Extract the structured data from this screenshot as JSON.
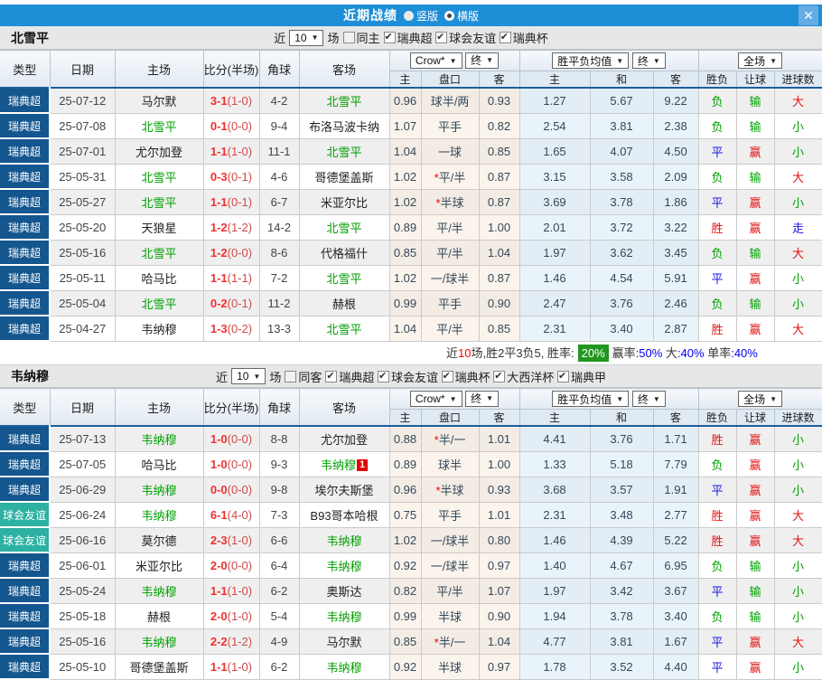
{
  "colors": {
    "topbar_blue": "#1e8ed7",
    "league_super_navy": "#14568e",
    "league_friendly_teal": "#2cb1a2",
    "focus_team_green": "#00a000",
    "score_red": "#f03030",
    "win_red": "#e11515",
    "draw_blue": "#1a1ae6",
    "lose_green": "#00a000",
    "summary_badge_green": "#21971f"
  },
  "titlebar": {
    "title": "近期战绩",
    "vertical_label": "竖版",
    "horizontal_label": "横版",
    "close_glyph": "✕"
  },
  "columns": {
    "main": [
      "类型",
      "日期",
      "主场",
      "比分(半场)",
      "角球",
      "客场"
    ],
    "sub": [
      "主",
      "盘口",
      "客",
      "主",
      "和",
      "客",
      "胜负",
      "让球",
      "进球数"
    ]
  },
  "dropdowns": {
    "company": "Crow*",
    "final": "终",
    "avg": "胜平负均值",
    "fulltime": "全场",
    "arrow": "▼"
  },
  "type_class": {
    "瑞典超": "ty-super",
    "球会友谊": "ty-friendly"
  },
  "result_class": {
    "胜": "c-red",
    "平": "c-blue",
    "负": "c-green",
    "赢": "c-red",
    "输": "c-green",
    "大": "c-red",
    "小": "c-green",
    "走": "c-blue"
  },
  "sections": [
    {
      "team": "北雪平",
      "focus": {
        "北雪平": "focus"
      },
      "filter": {
        "near": "近",
        "count": "10",
        "games": "场",
        "same": "同主",
        "leagues": [
          "瑞典超",
          "球会友谊",
          "瑞典杯"
        ]
      },
      "rows": [
        {
          "type": "瑞典超",
          "date": "25-07-12",
          "home": "马尔默",
          "score": "3-1",
          "half": "(1-0)",
          "corner": "4-2",
          "away": "北雪平",
          "o1": "0.96",
          "ast": "",
          "hcap": "球半/两",
          "o2": "0.93",
          "a1": "1.27",
          "a2": "5.67",
          "a3": "9.22",
          "r1": "负",
          "r2": "输",
          "r3": "大"
        },
        {
          "type": "瑞典超",
          "date": "25-07-08",
          "home": "北雪平",
          "score": "0-1",
          "half": "(0-0)",
          "corner": "9-4",
          "away": "布洛马波卡纳",
          "o1": "1.07",
          "ast": "",
          "hcap": "平手",
          "o2": "0.82",
          "a1": "2.54",
          "a2": "3.81",
          "a3": "2.38",
          "r1": "负",
          "r2": "输",
          "r3": "小"
        },
        {
          "type": "瑞典超",
          "date": "25-07-01",
          "home": "尤尔加登",
          "score": "1-1",
          "half": "(1-0)",
          "corner": "11-1",
          "away": "北雪平",
          "o1": "1.04",
          "ast": "",
          "hcap": "一球",
          "o2": "0.85",
          "a1": "1.65",
          "a2": "4.07",
          "a3": "4.50",
          "r1": "平",
          "r2": "赢",
          "r3": "小"
        },
        {
          "type": "瑞典超",
          "date": "25-05-31",
          "home": "北雪平",
          "score": "0-3",
          "half": "(0-1)",
          "corner": "4-6",
          "away": "哥德堡盖斯",
          "o1": "1.02",
          "ast": "*",
          "hcap": "平/半",
          "o2": "0.87",
          "a1": "3.15",
          "a2": "3.58",
          "a3": "2.09",
          "r1": "负",
          "r2": "输",
          "r3": "大"
        },
        {
          "type": "瑞典超",
          "date": "25-05-27",
          "home": "北雪平",
          "score": "1-1",
          "half": "(0-1)",
          "corner": "6-7",
          "away": "米亚尔比",
          "o1": "1.02",
          "ast": "*",
          "hcap": "半球",
          "o2": "0.87",
          "a1": "3.69",
          "a2": "3.78",
          "a3": "1.86",
          "r1": "平",
          "r2": "赢",
          "r3": "小"
        },
        {
          "type": "瑞典超",
          "date": "25-05-20",
          "home": "天狼星",
          "score": "1-2",
          "half": "(1-2)",
          "corner": "14-2",
          "away": "北雪平",
          "o1": "0.89",
          "ast": "",
          "hcap": "平/半",
          "o2": "1.00",
          "a1": "2.01",
          "a2": "3.72",
          "a3": "3.22",
          "r1": "胜",
          "r2": "赢",
          "r3": "走"
        },
        {
          "type": "瑞典超",
          "date": "25-05-16",
          "home": "北雪平",
          "score": "1-2",
          "half": "(0-0)",
          "corner": "8-6",
          "away": "代格福什",
          "o1": "0.85",
          "ast": "",
          "hcap": "平/半",
          "o2": "1.04",
          "a1": "1.97",
          "a2": "3.62",
          "a3": "3.45",
          "r1": "负",
          "r2": "输",
          "r3": "大"
        },
        {
          "type": "瑞典超",
          "date": "25-05-11",
          "home": "哈马比",
          "score": "1-1",
          "half": "(1-1)",
          "corner": "7-2",
          "away": "北雪平",
          "o1": "1.02",
          "ast": "",
          "hcap": "一/球半",
          "o2": "0.87",
          "a1": "1.46",
          "a2": "4.54",
          "a3": "5.91",
          "r1": "平",
          "r2": "赢",
          "r3": "小"
        },
        {
          "type": "瑞典超",
          "date": "25-05-04",
          "home": "北雪平",
          "score": "0-2",
          "half": "(0-1)",
          "corner": "11-2",
          "away": "赫根",
          "o1": "0.99",
          "ast": "",
          "hcap": "平手",
          "o2": "0.90",
          "a1": "2.47",
          "a2": "3.76",
          "a3": "2.46",
          "r1": "负",
          "r2": "输",
          "r3": "小"
        },
        {
          "type": "瑞典超",
          "date": "25-04-27",
          "home": "韦纳穆",
          "score": "1-3",
          "half": "(0-2)",
          "corner": "13-3",
          "away": "北雪平",
          "o1": "1.04",
          "ast": "",
          "hcap": "平/半",
          "o2": "0.85",
          "a1": "2.31",
          "a2": "3.40",
          "a3": "2.87",
          "r1": "胜",
          "r2": "赢",
          "r3": "大"
        }
      ],
      "summary": [
        {
          "t": "近"
        },
        {
          "t": "10",
          "c": "seg-red"
        },
        {
          "t": "场,胜2平3负5, 胜率:"
        },
        {
          "t": "20%",
          "c": "seg-badge"
        },
        {
          "t": "赢率"
        },
        {
          "t": ":50%",
          "c": "seg-blue"
        },
        {
          "t": " 大"
        },
        {
          "t": ":40%",
          "c": "seg-blue"
        },
        {
          "t": " 单率"
        },
        {
          "t": ":40%",
          "c": "seg-blue"
        }
      ]
    },
    {
      "team": "韦纳穆",
      "focus": {
        "韦纳穆": "focus"
      },
      "filter": {
        "near": "近",
        "count": "10",
        "games": "场",
        "same": "同客",
        "leagues": [
          "瑞典超",
          "球会友谊",
          "瑞典杯",
          "大西洋杯",
          "瑞典甲"
        ]
      },
      "rows": [
        {
          "type": "瑞典超",
          "date": "25-07-13",
          "home": "韦纳穆",
          "score": "1-0",
          "half": "(0-0)",
          "corner": "8-8",
          "away": "尤尔加登",
          "o1": "0.88",
          "ast": "*",
          "hcap": "半/一",
          "o2": "1.01",
          "a1": "4.41",
          "a2": "3.76",
          "a3": "1.71",
          "r1": "胜",
          "r2": "赢",
          "r3": "小"
        },
        {
          "type": "瑞典超",
          "date": "25-07-05",
          "home": "哈马比",
          "score": "1-0",
          "half": "(0-0)",
          "corner": "9-3",
          "away": "韦纳穆",
          "badge": "1",
          "o1": "0.89",
          "ast": "",
          "hcap": "球半",
          "o2": "1.00",
          "a1": "1.33",
          "a2": "5.18",
          "a3": "7.79",
          "r1": "负",
          "r2": "赢",
          "r3": "小"
        },
        {
          "type": "瑞典超",
          "date": "25-06-29",
          "home": "韦纳穆",
          "score": "0-0",
          "half": "(0-0)",
          "corner": "9-8",
          "away": "埃尔夫斯堡",
          "o1": "0.96",
          "ast": "*",
          "hcap": "半球",
          "o2": "0.93",
          "a1": "3.68",
          "a2": "3.57",
          "a3": "1.91",
          "r1": "平",
          "r2": "赢",
          "r3": "小"
        },
        {
          "type": "球会友谊",
          "date": "25-06-24",
          "home": "韦纳穆",
          "score": "6-1",
          "half": "(4-0)",
          "corner": "7-3",
          "away": "B93哥本哈根",
          "o1": "0.75",
          "ast": "",
          "hcap": "平手",
          "o2": "1.01",
          "a1": "2.31",
          "a2": "3.48",
          "a3": "2.77",
          "r1": "胜",
          "r2": "赢",
          "r3": "大"
        },
        {
          "type": "球会友谊",
          "date": "25-06-16",
          "home": "莫尔德",
          "score": "2-3",
          "half": "(1-0)",
          "corner": "6-6",
          "away": "韦纳穆",
          "o1": "1.02",
          "ast": "",
          "hcap": "一/球半",
          "o2": "0.80",
          "a1": "1.46",
          "a2": "4.39",
          "a3": "5.22",
          "r1": "胜",
          "r2": "赢",
          "r3": "大"
        },
        {
          "type": "瑞典超",
          "date": "25-06-01",
          "home": "米亚尔比",
          "score": "2-0",
          "half": "(0-0)",
          "corner": "6-4",
          "away": "韦纳穆",
          "o1": "0.92",
          "ast": "",
          "hcap": "一/球半",
          "o2": "0.97",
          "a1": "1.40",
          "a2": "4.67",
          "a3": "6.95",
          "r1": "负",
          "r2": "输",
          "r3": "小"
        },
        {
          "type": "瑞典超",
          "date": "25-05-24",
          "home": "韦纳穆",
          "score": "1-1",
          "half": "(1-0)",
          "corner": "6-2",
          "away": "奥斯达",
          "o1": "0.82",
          "ast": "",
          "hcap": "平/半",
          "o2": "1.07",
          "a1": "1.97",
          "a2": "3.42",
          "a3": "3.67",
          "r1": "平",
          "r2": "输",
          "r3": "小"
        },
        {
          "type": "瑞典超",
          "date": "25-05-18",
          "home": "赫根",
          "score": "2-0",
          "half": "(1-0)",
          "corner": "5-4",
          "away": "韦纳穆",
          "o1": "0.99",
          "ast": "",
          "hcap": "半球",
          "o2": "0.90",
          "a1": "1.94",
          "a2": "3.78",
          "a3": "3.40",
          "r1": "负",
          "r2": "输",
          "r3": "小"
        },
        {
          "type": "瑞典超",
          "date": "25-05-16",
          "home": "韦纳穆",
          "score": "2-2",
          "half": "(1-2)",
          "corner": "4-9",
          "away": "马尔默",
          "o1": "0.85",
          "ast": "*",
          "hcap": "半/一",
          "o2": "1.04",
          "a1": "4.77",
          "a2": "3.81",
          "a3": "1.67",
          "r1": "平",
          "r2": "赢",
          "r3": "大"
        },
        {
          "type": "瑞典超",
          "date": "25-05-10",
          "home": "哥德堡盖斯",
          "score": "1-1",
          "half": "(1-0)",
          "corner": "6-2",
          "away": "韦纳穆",
          "o1": "0.92",
          "ast": "",
          "hcap": "半球",
          "o2": "0.97",
          "a1": "1.78",
          "a2": "3.52",
          "a3": "4.40",
          "r1": "平",
          "r2": "赢",
          "r3": "小"
        }
      ]
    }
  ]
}
